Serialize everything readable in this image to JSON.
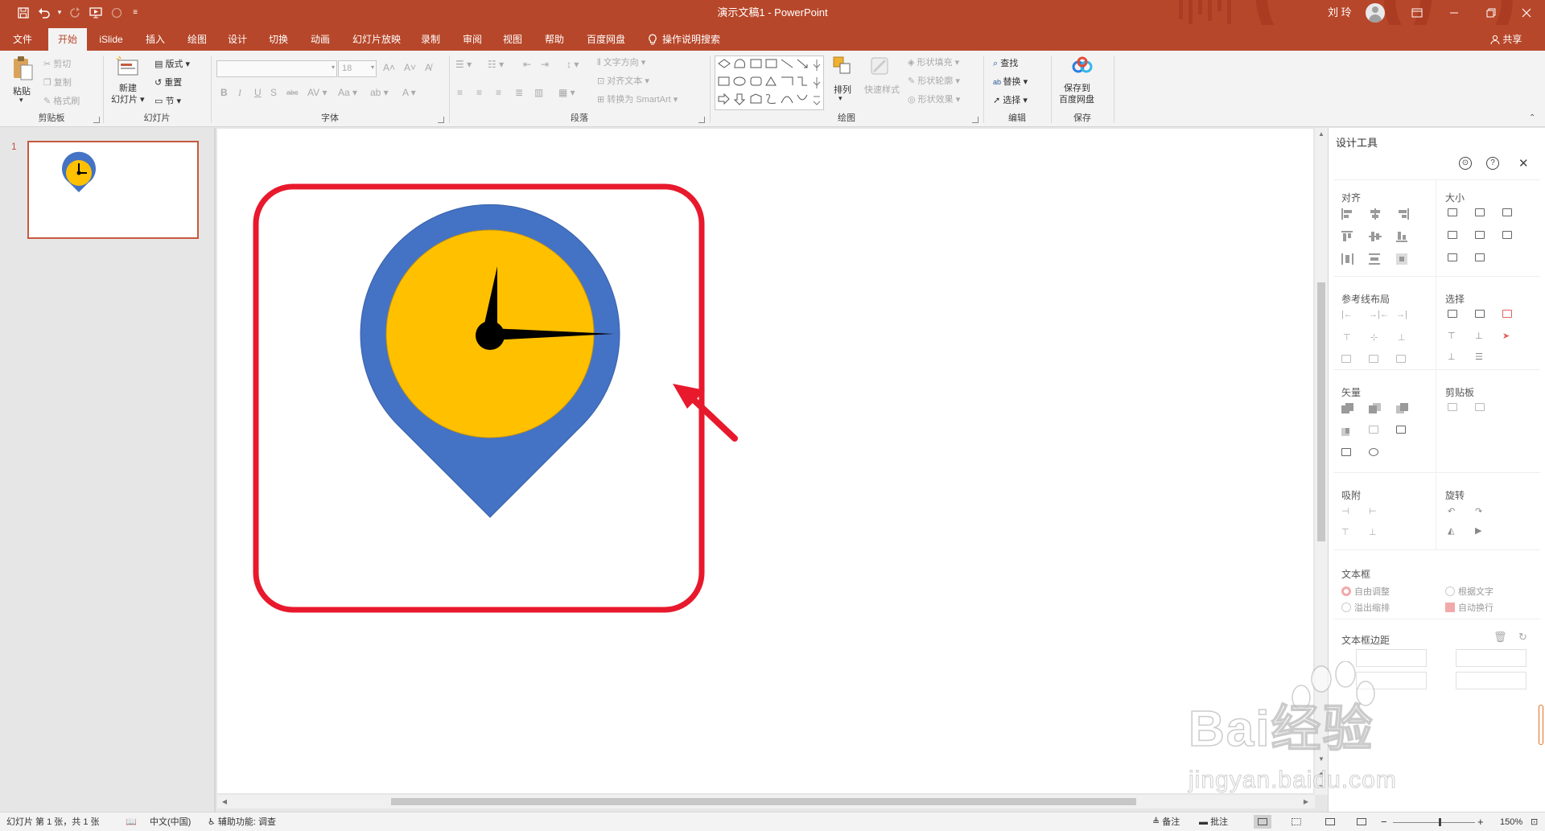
{
  "titlebar": {
    "title": "演示文稿1  -  PowerPoint",
    "user_name": "刘 玲",
    "colors": {
      "accent": "#b7472a"
    }
  },
  "tabs": [
    {
      "label": "文件"
    },
    {
      "label": "开始"
    },
    {
      "label": "iSlide"
    },
    {
      "label": "插入"
    },
    {
      "label": "绘图"
    },
    {
      "label": "设计"
    },
    {
      "label": "切换"
    },
    {
      "label": "动画"
    },
    {
      "label": "幻灯片放映"
    },
    {
      "label": "录制"
    },
    {
      "label": "审阅"
    },
    {
      "label": "视图"
    },
    {
      "label": "帮助"
    },
    {
      "label": "百度网盘"
    }
  ],
  "active_tab": "开始",
  "tellme": {
    "label": "操作说明搜索"
  },
  "share": {
    "label": "共享"
  },
  "ribbon": {
    "clipboard": {
      "paste": "粘贴",
      "cut": "剪切",
      "copy": "复制",
      "format_painter": "格式刷",
      "label": "剪贴板"
    },
    "slides": {
      "new_line1": "新建",
      "new_line2": "幻灯片",
      "layout": "版式",
      "reset": "重置",
      "section": "节",
      "label": "幻灯片"
    },
    "font": {
      "font_name": "",
      "font_size": "18",
      "label": "字体"
    },
    "paragraph": {
      "text_direction": "文字方向",
      "align_text": "对齐文本",
      "smartart": "转换为 SmartArt",
      "label": "段落"
    },
    "drawing": {
      "arrange": "排列",
      "quick_styles": "快速样式",
      "shape_fill": "形状填充",
      "shape_outline": "形状轮廓",
      "shape_effects": "形状效果",
      "label": "绘图"
    },
    "editing": {
      "find": "查找",
      "replace": "替换",
      "select": "选择",
      "label": "编辑"
    },
    "save": {
      "line1": "保存到",
      "line2": "百度网盘",
      "label": "保存"
    }
  },
  "thumbnails": [
    {
      "number": "1"
    }
  ],
  "design_tools": {
    "title": "设计工具",
    "sections": {
      "align": "对齐",
      "size": "大小",
      "guides": "参考线布局",
      "select": "选择",
      "vector": "矢量",
      "clipboard": "剪贴板",
      "snap": "吸附",
      "rotate": "旋转",
      "textbox": "文本框",
      "textbox_margin": "文本框边距"
    },
    "textbox_options": {
      "auto_adjust": "自由调整",
      "fit_text": "根据文字",
      "overflow": "溢出缩排",
      "auto_wrap": "自动换行"
    }
  },
  "statusbar": {
    "slide_info": "幻灯片 第 1 张，共 1 张",
    "language": "中文(中国)",
    "accessibility": "辅助功能: 调查",
    "notes": "备注",
    "comments": "批注",
    "zoom": "150%"
  },
  "watermark": {
    "brand": "Bai经验",
    "url": "jingyan.baidu.com"
  },
  "icons": {
    "save": "save-icon",
    "undo": "undo-icon",
    "redo": "redo-icon",
    "present": "start-presentation-icon",
    "tellme": "lightbulb-icon",
    "share": "person-icon",
    "arrow": "red-arrow-annotation"
  },
  "slide_content": {
    "graphic": "map-pin-clock-icon",
    "colors": {
      "pin": "#4472c4",
      "face": "#ffc000",
      "hands": "#000000",
      "highlight": "#e8192c",
      "arrow": "#e8192c"
    }
  }
}
